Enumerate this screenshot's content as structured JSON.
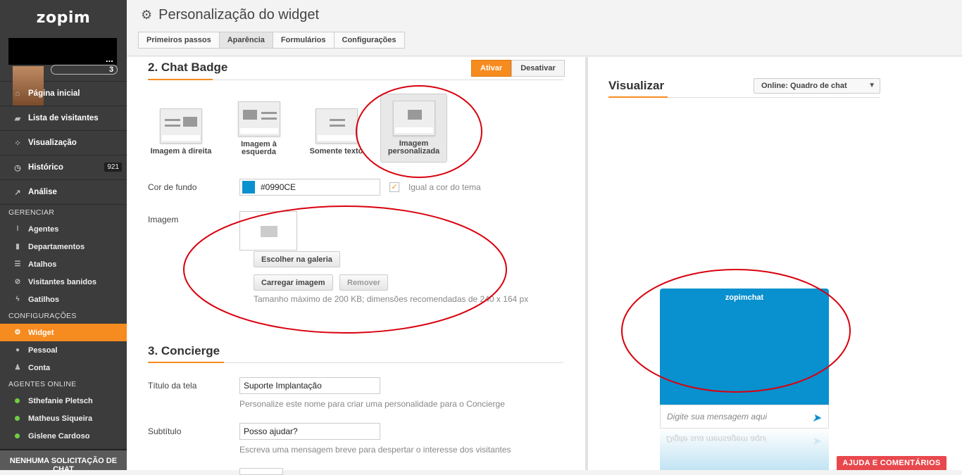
{
  "sidebar": {
    "logo": "zopim",
    "profile": {
      "dots": "...",
      "digit": "3"
    },
    "nav": [
      {
        "label": "Página inicial",
        "icon": "home-icon"
      },
      {
        "label": "Lista de visitantes",
        "icon": "chat-bubble-icon"
      },
      {
        "label": "Visualização",
        "icon": "share-icon"
      },
      {
        "label": "Histórico",
        "icon": "clock-icon",
        "count": "921"
      },
      {
        "label": "Análise",
        "icon": "chart-icon"
      }
    ],
    "sections": {
      "manage": "GERENCIAR",
      "config": "CONFIGURAÇÕES",
      "online": "AGENTES ONLINE"
    },
    "manage_items": [
      {
        "label": "Agentes"
      },
      {
        "label": "Departamentos"
      },
      {
        "label": "Atalhos"
      },
      {
        "label": "Visitantes banidos"
      },
      {
        "label": "Gatilhos"
      }
    ],
    "config_items": [
      {
        "label": "Widget"
      },
      {
        "label": "Pessoal"
      },
      {
        "label": "Conta"
      }
    ],
    "agents": [
      {
        "name": "Sthefanie Pletsch"
      },
      {
        "name": "Matheus Siqueira"
      },
      {
        "name": "Gislene Cardoso"
      }
    ],
    "no_chat": "NENHUMA SOLICITAÇÃO DE CHAT"
  },
  "header": {
    "title": "Personalização do widget",
    "tabs": [
      {
        "label": "Primeiros passos"
      },
      {
        "label": "Aparência"
      },
      {
        "label": "Formulários"
      },
      {
        "label": "Configurações"
      }
    ]
  },
  "badge": {
    "title": "2. Chat Badge",
    "activate": "Ativar",
    "deactivate": "Desativar",
    "options": [
      {
        "label": "Imagem à direita"
      },
      {
        "label": "Imagem à esquerda"
      },
      {
        "label": "Somente texto"
      },
      {
        "label": "Imagem personalizada"
      }
    ],
    "bg_label": "Cor de fundo",
    "bg_value": "#0990CE",
    "theme_label": "Igual a cor do tema",
    "image_label": "Imagem",
    "gallery_btn": "Escolher na galeria",
    "upload_btn": "Carregar imagem",
    "remove_btn": "Remover",
    "size_hint": "Tamanho máximo de 200 KB; dimensões recomendadas de 240 x 164 px"
  },
  "concierge": {
    "title": "3. Concierge",
    "screen_title_label": "Título da tela",
    "screen_title_value": "Suporte Implantação",
    "screen_title_hint": "Personalize este nome para criar uma personalidade para o Concierge",
    "subtitle_label": "Subtítulo",
    "subtitle_value": "Posso ajudar?",
    "subtitle_hint": "Escreva uma mensagem breve para despertar o interesse dos visitantes"
  },
  "preview": {
    "title": "Visualizar",
    "mode": "Online: Quadro de chat",
    "brand": "zopimchat",
    "message_placeholder": "Digite sua mensagem aqui"
  },
  "help": "AJUDA E COMENTÁRIOS",
  "colors": {
    "accent": "#f68b1f",
    "brand": "#0990ce",
    "sidebar": "#3c3c3c",
    "annotation": "#d9000d"
  }
}
